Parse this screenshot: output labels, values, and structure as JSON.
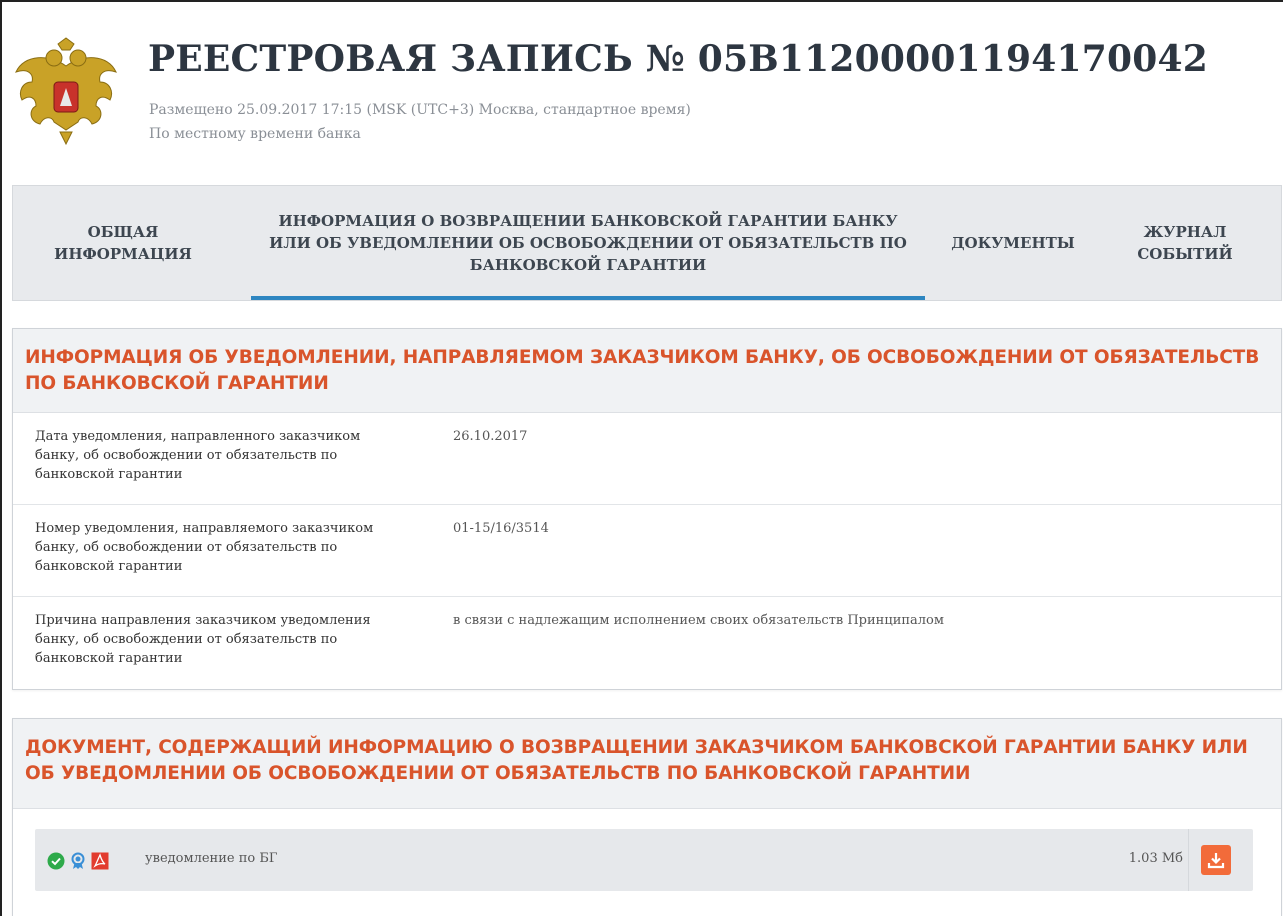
{
  "header": {
    "title": "РЕЕСТРОВАЯ ЗАПИСЬ № 05B11200001194170042",
    "posted": "Размещено 25.09.2017 17:15 (MSK (UTC+3) Москва, стандартное время)",
    "local_time_note": "По местному времени банка"
  },
  "tabs": [
    {
      "label": "ОБЩАЯ\nИНФОРМАЦИЯ"
    },
    {
      "label": "ИНФОРМАЦИЯ О ВОЗВРАЩЕНИИ БАНКОВСКОЙ ГАРАНТИИ БАНКУ\nИЛИ ОБ УВЕДОМЛЕНИИ ОБ ОСВОБОЖДЕНИИ ОТ ОБЯЗАТЕЛЬСТВ ПО\nБАНКОВСКОЙ ГАРАНТИИ"
    },
    {
      "label": "ДОКУМЕНТЫ"
    },
    {
      "label": "ЖУРНАЛ\nСОБЫТИЙ"
    }
  ],
  "notice_section": {
    "title": "ИНФОРМАЦИЯ ОБ УВЕДОМЛЕНИИ, НАПРАВЛЯЕМОМ ЗАКАЗЧИКОМ БАНКУ, ОБ ОСВОБОЖДЕНИИ ОТ ОБЯЗАТЕЛЬСТВ ПО БАНКОВСКОЙ ГАРАНТИИ",
    "rows": [
      {
        "label": "Дата уведомления, направленного заказчиком банку, об освобождении от обязательств по банковской гарантии",
        "value": "26.10.2017"
      },
      {
        "label": "Номер уведомления, направляемого заказчиком банку, об освобождении от обязательств по банковской гарантии",
        "value": "01-15/16/3514"
      },
      {
        "label": "Причина направления заказчиком уведомления банку, об освобождении от обязательств по банковской гарантии",
        "value": "в связи с надлежащим исполнением своих обязательств Принципалом"
      }
    ]
  },
  "document_section": {
    "title": "ДОКУМЕНТ, СОДЕРЖАЩИЙ ИНФОРМАЦИЮ О ВОЗВРАЩЕНИИ ЗАКАЗЧИКОМ БАНКОВСКОЙ ГАРАНТИИ БАНКУ ИЛИ ОБ УВЕДОМЛЕНИИ ОБ ОСВОБОЖДЕНИИ ОТ ОБЯЗАТЕЛЬСТВ ПО БАНКОВСКОЙ ГАРАНТИИ",
    "file": {
      "name": "уведомление по БГ",
      "size": "1.03 Мб",
      "icons": [
        "verified-check-icon",
        "signature-certificate-icon",
        "pdf-file-icon"
      ],
      "download_icon": "download-icon"
    }
  },
  "colors": {
    "accent_orange": "#d9542b",
    "tab_active": "#2e86c1",
    "download_button": "#f26b3a",
    "check_green": "#2eaa4a",
    "cert_blue": "#3a8fd6",
    "pdf_red": "#e23b2e"
  }
}
